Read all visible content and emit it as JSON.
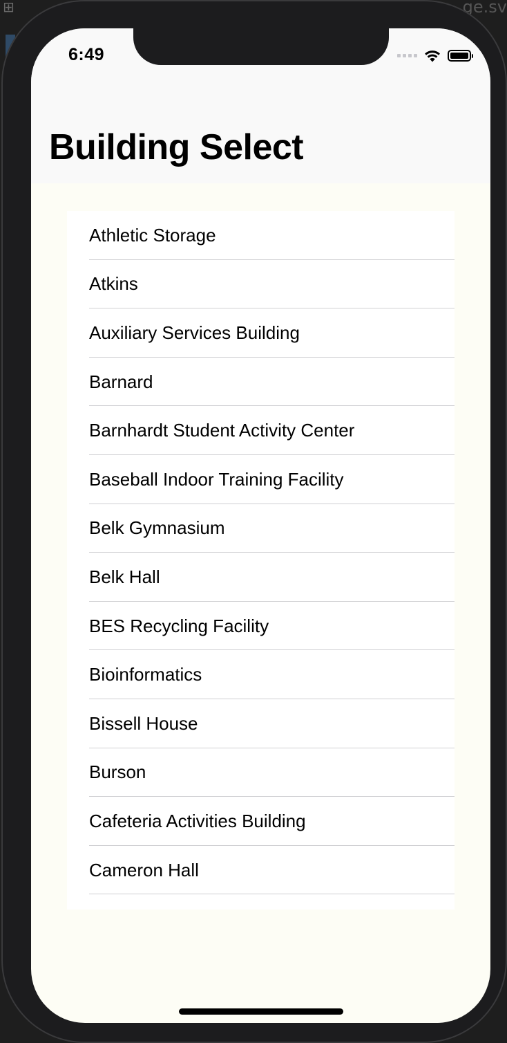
{
  "status_bar": {
    "time": "6:49"
  },
  "background": {
    "editor_text": "ge.sv"
  },
  "navigation": {
    "title": "Building Select"
  },
  "buildings": [
    "Athletic Storage",
    "Atkins",
    "Auxiliary Services Building",
    "Barnard",
    "Barnhardt Student Activity Center",
    "Baseball Indoor Training Facility",
    "Belk Gymnasium",
    "Belk Hall",
    "BES Recycling Facility",
    "Bioinformatics",
    "Bissell House",
    "Burson",
    "Cafeteria Activities Building",
    "Cameron Hall"
  ],
  "icons": {
    "signal": "cellular-signal-icon",
    "wifi": "wifi-icon",
    "battery": "battery-icon"
  },
  "colors": {
    "navbar_background": "#f9f9f9",
    "content_background": "#fdfdf5",
    "list_background": "#ffffff",
    "separator": "#cfcfd2",
    "text": "#000000"
  }
}
